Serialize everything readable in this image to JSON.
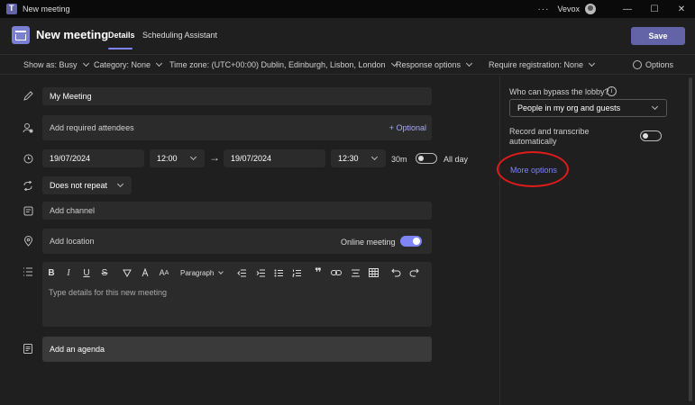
{
  "window": {
    "title": "New meeting",
    "user": "Vevox",
    "more_glyph": "···",
    "min_glyph": "—",
    "max_glyph": "☐",
    "close_glyph": "✕"
  },
  "header": {
    "title": "New meeting",
    "tabs": [
      "Details",
      "Scheduling Assistant"
    ],
    "save_label": "Save"
  },
  "options_bar": {
    "show_as": "Show as: Busy",
    "category": "Category: None",
    "time_zone": "Time zone: (UTC+00:00) Dublin, Edinburgh, Lisbon, London",
    "response_options": "Response options",
    "registration": "Require registration: None",
    "options": "Options"
  },
  "form": {
    "title_value": "My Meeting",
    "attendees_placeholder": "Add required attendees",
    "optional_label": "+ Optional",
    "start_date": "19/07/2024",
    "start_time": "12:00",
    "end_date": "19/07/2024",
    "end_time": "12:30",
    "duration": "30m",
    "all_day_label": "All day",
    "all_day_on": false,
    "repeat_value": "Does not repeat",
    "channel_placeholder": "Add channel",
    "location_placeholder": "Add location",
    "online_meeting_label": "Online meeting",
    "online_meeting_on": true,
    "paragraph_label": "Paragraph",
    "details_placeholder": "Type details for this new meeting",
    "agenda_label": "Add an agenda"
  },
  "toolbar": [
    "B",
    "I",
    "U",
    "S",
    "highlight",
    "font-color",
    "font-size",
    "paragraph",
    "outdent",
    "indent",
    "bullets",
    "numbering",
    "quote",
    "link",
    "align",
    "table",
    "undo",
    "redo"
  ],
  "side_panel": {
    "lobby_label": "Who can bypass the lobby?",
    "lobby_value": "People in my org and guests",
    "record_label": "Record and transcribe automatically",
    "record_on": false,
    "more_options": "More options"
  },
  "colors": {
    "accent": "#6264a7",
    "accent_light": "#7f85f5",
    "annotation": "#e01b1b"
  }
}
